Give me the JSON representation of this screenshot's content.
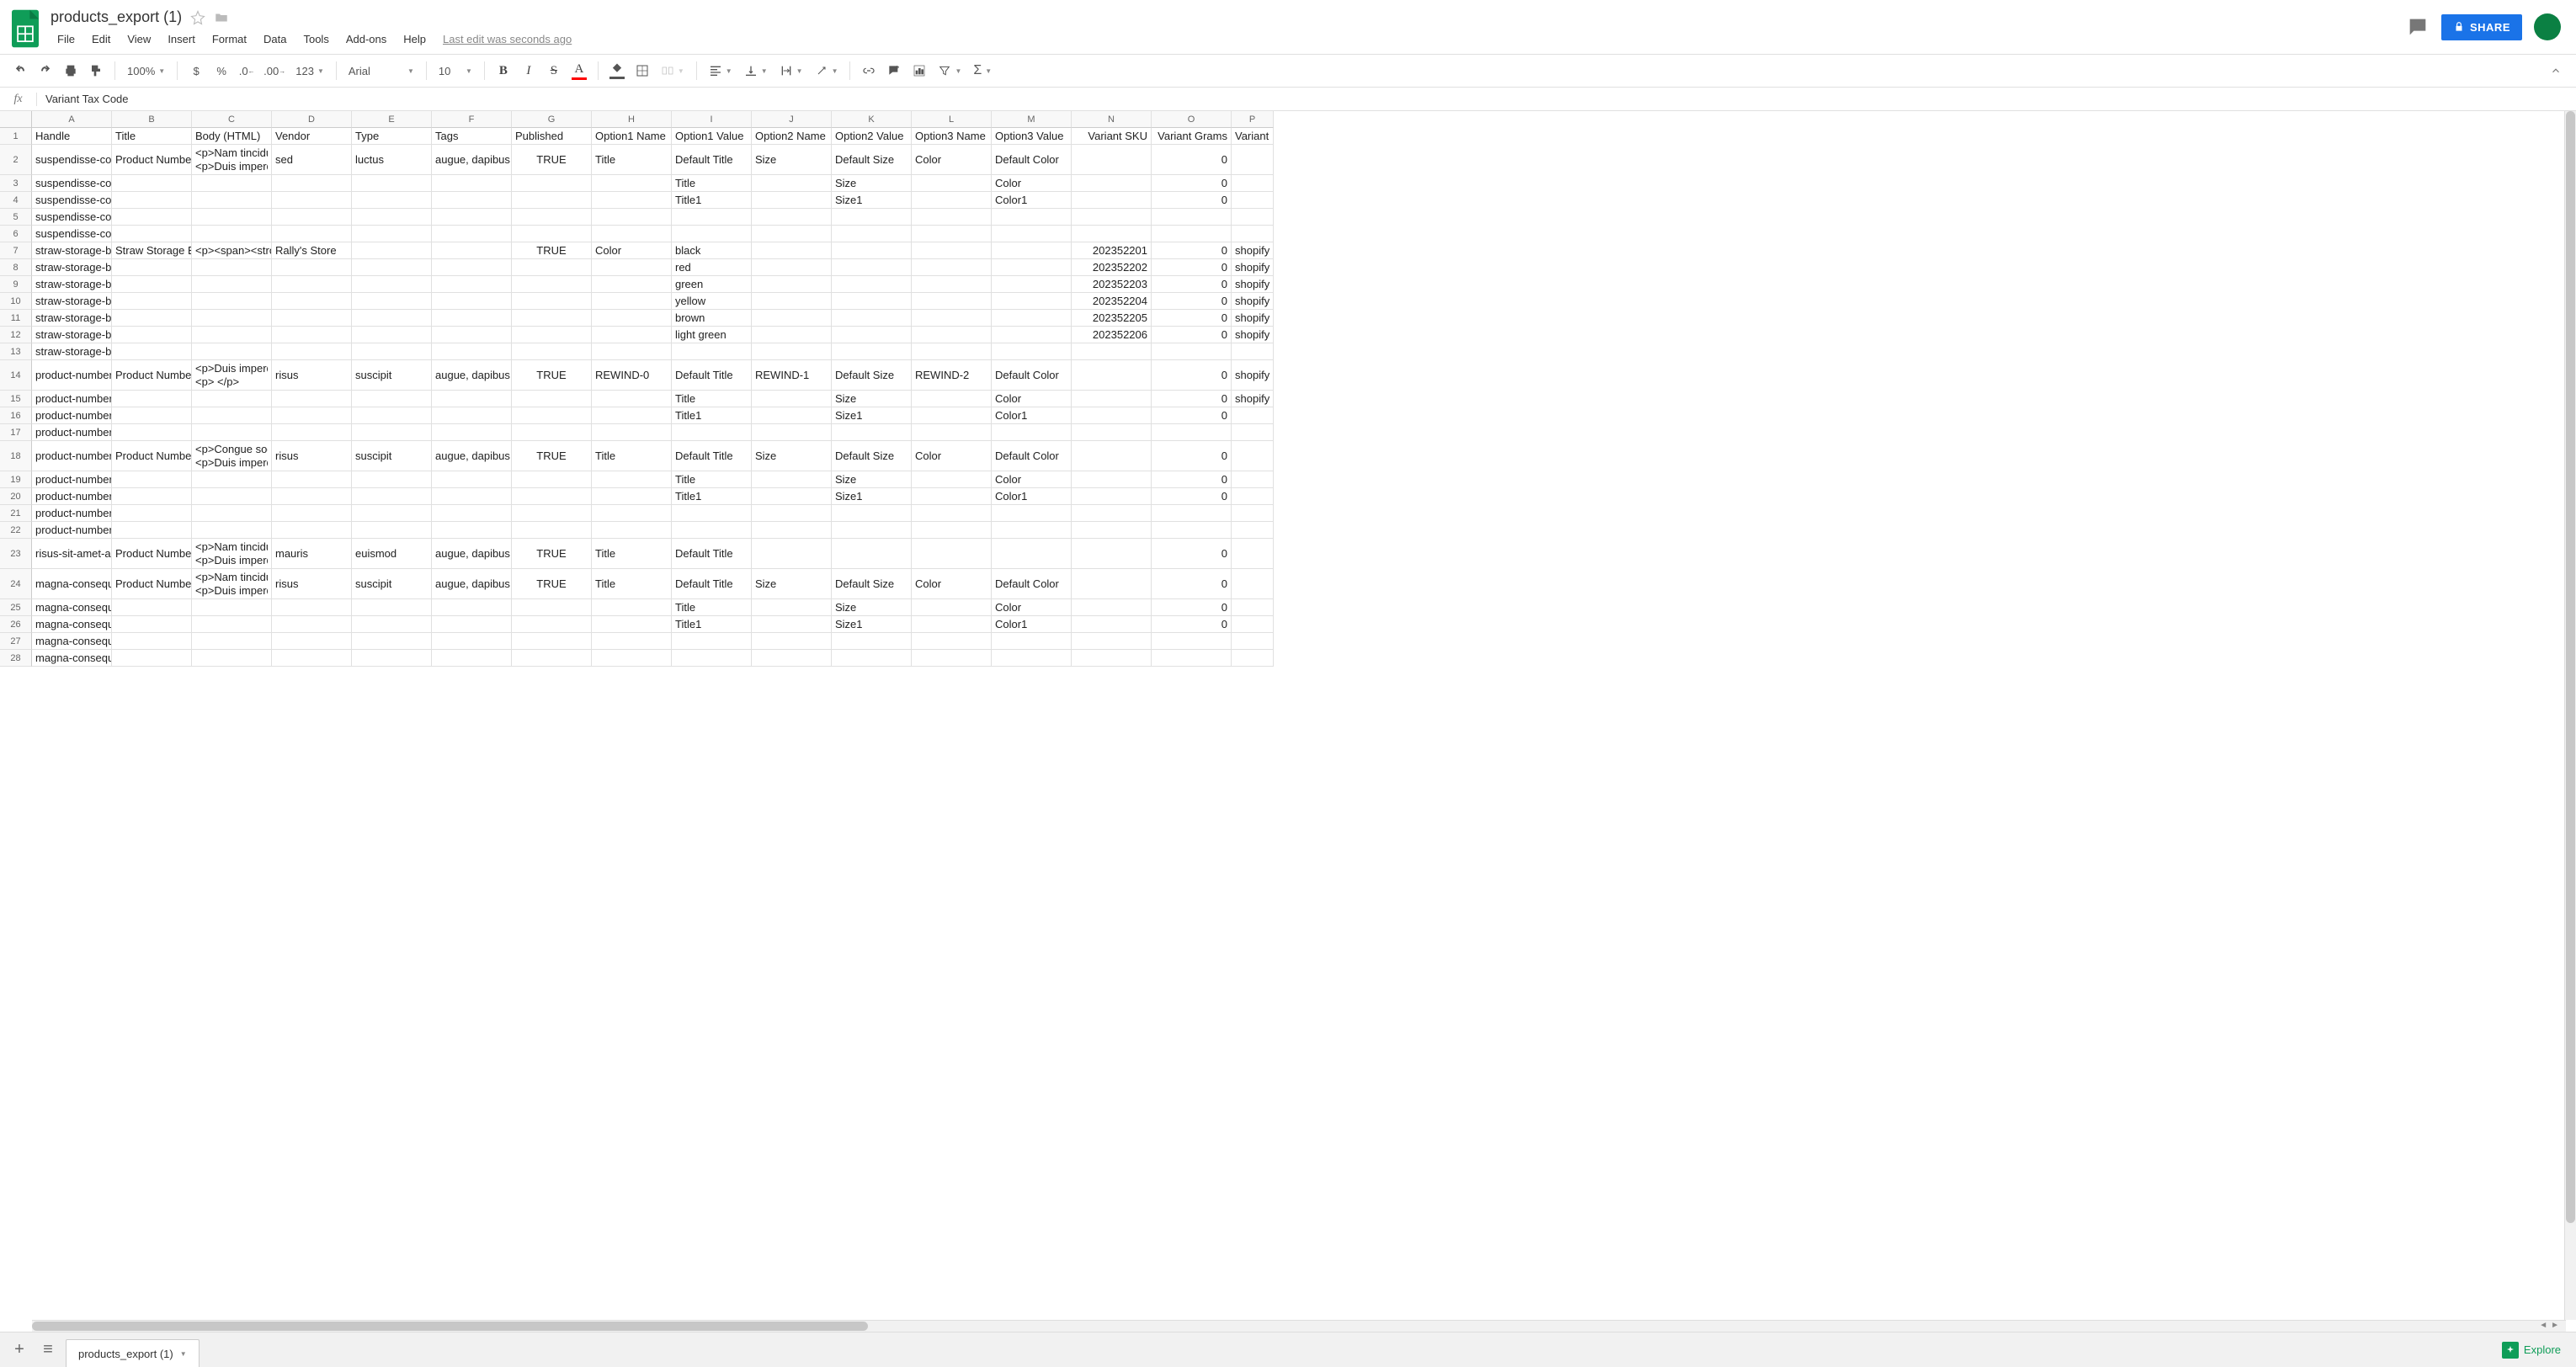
{
  "doc": {
    "name": "products_export (1)"
  },
  "menu": [
    "File",
    "Edit",
    "View",
    "Insert",
    "Format",
    "Data",
    "Tools",
    "Add-ons",
    "Help"
  ],
  "last_edit": "Last edit was seconds ago",
  "share_label": "SHARE",
  "toolbar": {
    "zoom": "100%",
    "font": "Arial",
    "font_size": "10",
    "numfmt": "123"
  },
  "fx": {
    "label": "fx",
    "value": "Variant Tax Code"
  },
  "columns": [
    {
      "letter": "A",
      "width": 95,
      "label": "Handle"
    },
    {
      "letter": "B",
      "width": 95,
      "label": "Title"
    },
    {
      "letter": "C",
      "width": 95,
      "label": "Body (HTML)"
    },
    {
      "letter": "D",
      "width": 95,
      "label": "Vendor"
    },
    {
      "letter": "E",
      "width": 95,
      "label": "Type"
    },
    {
      "letter": "F",
      "width": 95,
      "label": "Tags"
    },
    {
      "letter": "G",
      "width": 95,
      "label": "Published",
      "align": "ctr"
    },
    {
      "letter": "H",
      "width": 95,
      "label": "Option1 Name"
    },
    {
      "letter": "I",
      "width": 95,
      "label": "Option1 Value"
    },
    {
      "letter": "J",
      "width": 95,
      "label": "Option2 Name"
    },
    {
      "letter": "K",
      "width": 95,
      "label": "Option2 Value"
    },
    {
      "letter": "L",
      "width": 95,
      "label": "Option3 Name"
    },
    {
      "letter": "M",
      "width": 95,
      "label": "Option3 Value"
    },
    {
      "letter": "N",
      "width": 95,
      "label": "Variant SKU",
      "align": "num"
    },
    {
      "letter": "O",
      "width": 95,
      "label": "Variant Grams",
      "align": "num"
    },
    {
      "letter": "P",
      "width": 50,
      "label": "Variant I"
    }
  ],
  "rows": [
    {
      "n": 1,
      "h": 20,
      "cells": [
        "Handle",
        "Title",
        "Body (HTML)",
        "Vendor",
        "Type",
        "Tags",
        "Published",
        "Option1 Name",
        "Option1 Value",
        "Option2 Name",
        "Option2 Value",
        "Option3 Name",
        "Option3 Value",
        "Variant SKU",
        "Variant Grams",
        "Variant I"
      ],
      "header": true
    },
    {
      "n": 2,
      "h": 36,
      "cells": [
        "suspendisse-con",
        "Product Number",
        "<p>Nam tincidun\n<p>Duis imperdi",
        "sed",
        "luctus",
        "augue, dapibus,",
        "TRUE",
        "Title",
        "Default Title",
        "Size",
        "Default Size",
        "Color",
        "Default Color",
        "",
        "0",
        ""
      ]
    },
    {
      "n": 3,
      "h": 20,
      "cells": [
        "suspendisse-congue-sodales-massa-sit-amet-euismod-aliquet-sapien-non-dictum",
        "",
        "",
        "",
        "",
        "",
        "",
        "",
        "Title",
        "",
        "Size",
        "",
        "Color",
        "",
        "0",
        ""
      ],
      "overflowA": true
    },
    {
      "n": 4,
      "h": 20,
      "cells": [
        "suspendisse-congue-sodales-massa-sit-amet-euismod-aliquet-sapien-non-dictum",
        "",
        "",
        "",
        "",
        "",
        "",
        "",
        "Title1",
        "",
        "Size1",
        "",
        "Color1",
        "",
        "0",
        ""
      ],
      "overflowA": true
    },
    {
      "n": 5,
      "h": 20,
      "cells": [
        "suspendisse-congue-sodales-massa-sit-amet-euismod-aliquet-sapien-non-dictum",
        "",
        "",
        "",
        "",
        "",
        "",
        "",
        "",
        "",
        "",
        "",
        "",
        "",
        "",
        ""
      ],
      "overflowA": true
    },
    {
      "n": 6,
      "h": 20,
      "cells": [
        "suspendisse-congue-sodales-massa-sit-amet-euismod-aliquet-sapien-non-dictum",
        "",
        "",
        "",
        "",
        "",
        "",
        "",
        "",
        "",
        "",
        "",
        "",
        "",
        "",
        ""
      ],
      "overflowA": true
    },
    {
      "n": 7,
      "h": 20,
      "cells": [
        "straw-storage-ba",
        "Straw Storage B",
        "<p><span><stro",
        "Rally's Store",
        "",
        "",
        "TRUE",
        "Color",
        "black",
        "",
        "",
        "",
        "",
        "202352201",
        "0",
        "shopify"
      ]
    },
    {
      "n": 8,
      "h": 20,
      "cells": [
        "straw-storage-basket-flower-pot",
        "",
        "",
        "",
        "",
        "",
        "",
        "",
        "red",
        "",
        "",
        "",
        "",
        "202352202",
        "0",
        "shopify"
      ],
      "overflowA": true
    },
    {
      "n": 9,
      "h": 20,
      "cells": [
        "straw-storage-basket-flower-pot",
        "",
        "",
        "",
        "",
        "",
        "",
        "",
        "green",
        "",
        "",
        "",
        "",
        "202352203",
        "0",
        "shopify"
      ],
      "overflowA": true
    },
    {
      "n": 10,
      "h": 20,
      "cells": [
        "straw-storage-basket-flower-pot",
        "",
        "",
        "",
        "",
        "",
        "",
        "",
        "yellow",
        "",
        "",
        "",
        "",
        "202352204",
        "0",
        "shopify"
      ],
      "overflowA": true
    },
    {
      "n": 11,
      "h": 20,
      "cells": [
        "straw-storage-basket-flower-pot",
        "",
        "",
        "",
        "",
        "",
        "",
        "",
        "brown",
        "",
        "",
        "",
        "",
        "202352205",
        "0",
        "shopify"
      ],
      "overflowA": true
    },
    {
      "n": 12,
      "h": 20,
      "cells": [
        "straw-storage-basket-flower-pot",
        "",
        "",
        "",
        "",
        "",
        "",
        "",
        "light green",
        "",
        "",
        "",
        "",
        "202352206",
        "0",
        "shopify"
      ],
      "overflowA": true
    },
    {
      "n": 13,
      "h": 20,
      "cells": [
        "straw-storage-basket-flower-pot",
        "",
        "",
        "",
        "",
        "",
        "",
        "",
        "",
        "",
        "",
        "",
        "",
        "",
        "",
        ""
      ],
      "overflowA": true
    },
    {
      "n": 14,
      "h": 36,
      "cells": [
        "product-number-",
        "Product Number",
        "<p>Duis imperdi\n<p> </p>",
        "risus",
        "suscipit",
        "augue, dapibus,",
        "TRUE",
        "REWIND-0",
        "Default Title",
        "REWIND-1",
        "Default Size",
        "REWIND-2",
        "Default Color",
        "",
        "0",
        "shopify"
      ]
    },
    {
      "n": 15,
      "h": 20,
      "cells": [
        "product-number-nine",
        "",
        "",
        "",
        "",
        "",
        "",
        "",
        "Title",
        "",
        "Size",
        "",
        "Color",
        "",
        "0",
        "shopify"
      ],
      "overflowA": true
    },
    {
      "n": 16,
      "h": 20,
      "cells": [
        "product-number-nine",
        "",
        "",
        "",
        "",
        "",
        "",
        "",
        "Title1",
        "",
        "Size1",
        "",
        "Color1",
        "",
        "0",
        ""
      ],
      "overflowA": true
    },
    {
      "n": 17,
      "h": 20,
      "cells": [
        "product-number-nine",
        "",
        "",
        "",
        "",
        "",
        "",
        "",
        "",
        "",
        "",
        "",
        "",
        "",
        "",
        ""
      ],
      "overflowA": true
    },
    {
      "n": 18,
      "h": 36,
      "cells": [
        "product-number-",
        "Product Number",
        "<p>Congue soda\n<p>Duis imperdi",
        "risus",
        "suscipit",
        "augue, dapibus,",
        "TRUE",
        "Title",
        "Default Title",
        "Size",
        "Default Size",
        "Color",
        "Default Color",
        "",
        "0",
        ""
      ]
    },
    {
      "n": 19,
      "h": 20,
      "cells": [
        "product-number-ten",
        "",
        "",
        "",
        "",
        "",
        "",
        "",
        "Title",
        "",
        "Size",
        "",
        "Color",
        "",
        "0",
        ""
      ],
      "overflowA": true
    },
    {
      "n": 20,
      "h": 20,
      "cells": [
        "product-number-ten",
        "",
        "",
        "",
        "",
        "",
        "",
        "",
        "Title1",
        "",
        "Size1",
        "",
        "Color1",
        "",
        "0",
        ""
      ],
      "overflowA": true
    },
    {
      "n": 21,
      "h": 20,
      "cells": [
        "product-number-ten",
        "",
        "",
        "",
        "",
        "",
        "",
        "",
        "",
        "",
        "",
        "",
        "",
        "",
        "",
        ""
      ],
      "overflowA": true
    },
    {
      "n": 22,
      "h": 20,
      "cells": [
        "product-number-ten",
        "",
        "",
        "",
        "",
        "",
        "",
        "",
        "",
        "",
        "",
        "",
        "",
        "",
        "",
        ""
      ],
      "overflowA": true
    },
    {
      "n": 23,
      "h": 36,
      "cells": [
        "risus-sit-amet-an",
        "Product Number",
        "<p>Nam tincidun\n<p>Duis imperdi",
        "mauris",
        "euismod",
        "augue, dapibus,",
        "TRUE",
        "Title",
        "Default Title",
        "",
        "",
        "",
        "",
        "",
        "0",
        ""
      ]
    },
    {
      "n": 24,
      "h": 36,
      "cells": [
        "magna-consequa",
        "Product Number",
        "<p>Nam tincidun\n<p>Duis imperdi",
        "risus",
        "suscipit",
        "augue, dapibus,",
        "TRUE",
        "Title",
        "Default Title",
        "Size",
        "Default Size",
        "Color",
        "Default Color",
        "",
        "0",
        ""
      ]
    },
    {
      "n": 25,
      "h": 20,
      "cells": [
        "magna-consequat-nec-dictum-luctus",
        "",
        "",
        "",
        "",
        "",
        "",
        "",
        "Title",
        "",
        "Size",
        "",
        "Color",
        "",
        "0",
        ""
      ],
      "overflowA": true
    },
    {
      "n": 26,
      "h": 20,
      "cells": [
        "magna-consequat-nec-dictum-luctus",
        "",
        "",
        "",
        "",
        "",
        "",
        "",
        "Title1",
        "",
        "Size1",
        "",
        "Color1",
        "",
        "0",
        ""
      ],
      "overflowA": true
    },
    {
      "n": 27,
      "h": 20,
      "cells": [
        "magna-consequat-nec-dictum-luctus",
        "",
        "",
        "",
        "",
        "",
        "",
        "",
        "",
        "",
        "",
        "",
        "",
        "",
        "",
        ""
      ],
      "overflowA": true
    },
    {
      "n": 28,
      "h": 20,
      "cells": [
        "magna-consequat-nec-dictum-luctus",
        "",
        "",
        "",
        "",
        "",
        "",
        "",
        "",
        "",
        "",
        "",
        "",
        "",
        "",
        ""
      ],
      "overflowA": true
    }
  ],
  "sheet_tab": "products_export (1)",
  "explore": "Explore"
}
